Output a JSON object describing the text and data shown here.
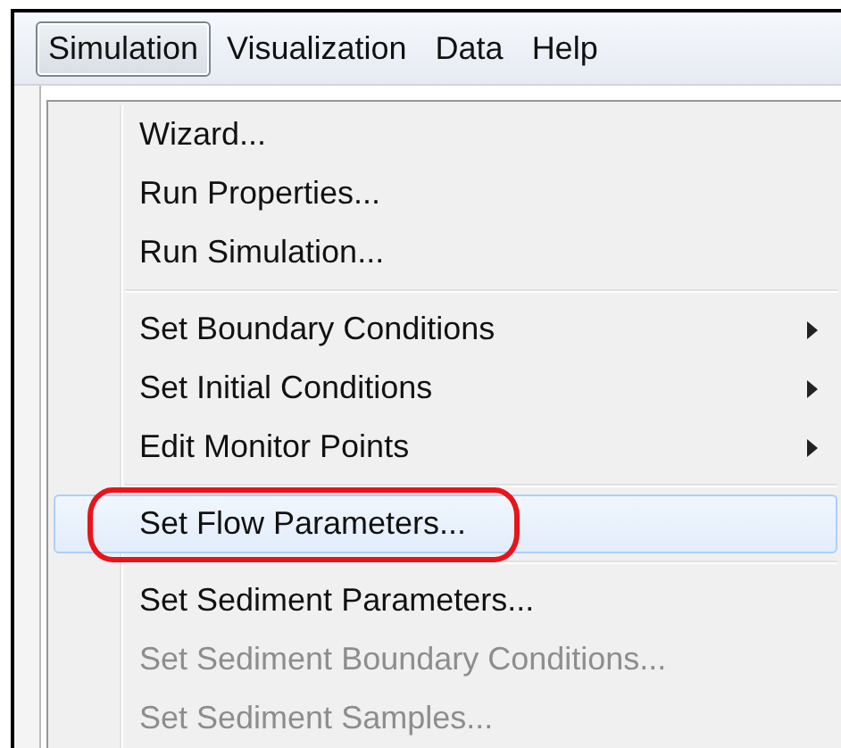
{
  "menu_bar": [
    {
      "label": "Simulation",
      "selected": true
    },
    {
      "label": "Visualization",
      "selected": false
    },
    {
      "label": "Data",
      "selected": false
    },
    {
      "label": "Help",
      "selected": false
    }
  ],
  "menu": {
    "items": [
      {
        "kind": "item",
        "label": "Wizard...",
        "disabled": false,
        "submenu": false,
        "selected": false,
        "circled": false
      },
      {
        "kind": "item",
        "label": "Run Properties...",
        "disabled": false,
        "submenu": false,
        "selected": false,
        "circled": false
      },
      {
        "kind": "item",
        "label": "Run Simulation...",
        "disabled": false,
        "submenu": false,
        "selected": false,
        "circled": false
      },
      {
        "kind": "separator"
      },
      {
        "kind": "item",
        "label": "Set Boundary Conditions",
        "disabled": false,
        "submenu": true,
        "selected": false,
        "circled": false
      },
      {
        "kind": "item",
        "label": "Set Initial Conditions",
        "disabled": false,
        "submenu": true,
        "selected": false,
        "circled": false
      },
      {
        "kind": "item",
        "label": "Edit Monitor Points",
        "disabled": false,
        "submenu": true,
        "selected": false,
        "circled": false
      },
      {
        "kind": "separator"
      },
      {
        "kind": "item",
        "label": "Set Flow Parameters...",
        "disabled": false,
        "submenu": false,
        "selected": true,
        "circled": true
      },
      {
        "kind": "separator"
      },
      {
        "kind": "item",
        "label": "Set Sediment Parameters...",
        "disabled": false,
        "submenu": false,
        "selected": false,
        "circled": false
      },
      {
        "kind": "item",
        "label": "Set Sediment Boundary Conditions...",
        "disabled": true,
        "submenu": false,
        "selected": false,
        "circled": false
      },
      {
        "kind": "item",
        "label": "Set Sediment Samples...",
        "disabled": true,
        "submenu": false,
        "selected": false,
        "circled": false
      }
    ]
  }
}
